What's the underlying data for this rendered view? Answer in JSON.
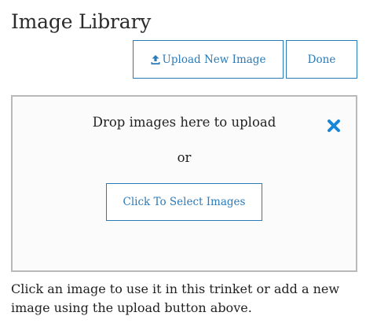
{
  "header": {
    "title": "Image Library"
  },
  "toolbar": {
    "upload_label": "Upload New Image",
    "upload_icon": "upload-icon",
    "done_label": "Done"
  },
  "dropzone": {
    "prompt": "Drop images here to upload",
    "or_text": "or",
    "select_label": "Click To Select Images",
    "close_icon": "close-icon"
  },
  "helper_text": "Click an image to use it in this trinket or add a new image using the upload button above.",
  "colors": {
    "accent": "#2a7ab8",
    "dropzone_border": "#b9b9b9",
    "close_icon": "#1a86d8"
  }
}
